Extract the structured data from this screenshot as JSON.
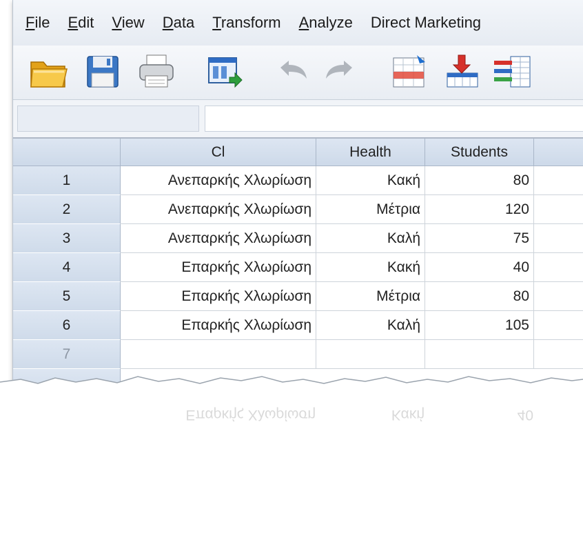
{
  "menu": {
    "items": [
      {
        "label": "File",
        "ul": "F",
        "rest": "ile"
      },
      {
        "label": "Edit",
        "ul": "E",
        "rest": "dit"
      },
      {
        "label": "View",
        "ul": "V",
        "rest": "iew"
      },
      {
        "label": "Data",
        "ul": "D",
        "rest": "ata"
      },
      {
        "label": "Transform",
        "ul": "T",
        "rest": "ransform"
      },
      {
        "label": "Analyze",
        "ul": "A",
        "rest": "nalyze"
      },
      {
        "label": "Direct Marketing",
        "ul": "",
        "rest": "Direct Marketing"
      }
    ]
  },
  "toolbar": {
    "icons": [
      "open-folder-icon",
      "save-disk-icon",
      "print-icon",
      "dialog-recall-icon",
      "undo-icon",
      "redo-icon",
      "goto-case-icon",
      "goto-variable-icon",
      "variables-icon"
    ]
  },
  "grid": {
    "columns": [
      "Cl",
      "Health",
      "Students"
    ],
    "rows": [
      {
        "num": "1",
        "cl": "Ανεπαρκής Χλωρίωση",
        "health": "Κακή",
        "students": "80"
      },
      {
        "num": "2",
        "cl": "Ανεπαρκής Χλωρίωση",
        "health": "Μέτρια",
        "students": "120"
      },
      {
        "num": "3",
        "cl": "Ανεπαρκής Χλωρίωση",
        "health": "Καλή",
        "students": "75"
      },
      {
        "num": "4",
        "cl": "Επαρκής Χλωρίωση",
        "health": "Κακή",
        "students": "40"
      },
      {
        "num": "5",
        "cl": "Επαρκής Χλωρίωση",
        "health": "Μέτρια",
        "students": "80"
      },
      {
        "num": "6",
        "cl": "Επαρκής Χλωρίωση",
        "health": "Καλή",
        "students": "105"
      },
      {
        "num": "7",
        "cl": "",
        "health": "",
        "students": ""
      }
    ]
  },
  "colors": {
    "header_blue": "#d6e1ef",
    "grid_line": "#cdd3da",
    "accent_red": "#d6312b",
    "accent_green": "#3aa346"
  }
}
